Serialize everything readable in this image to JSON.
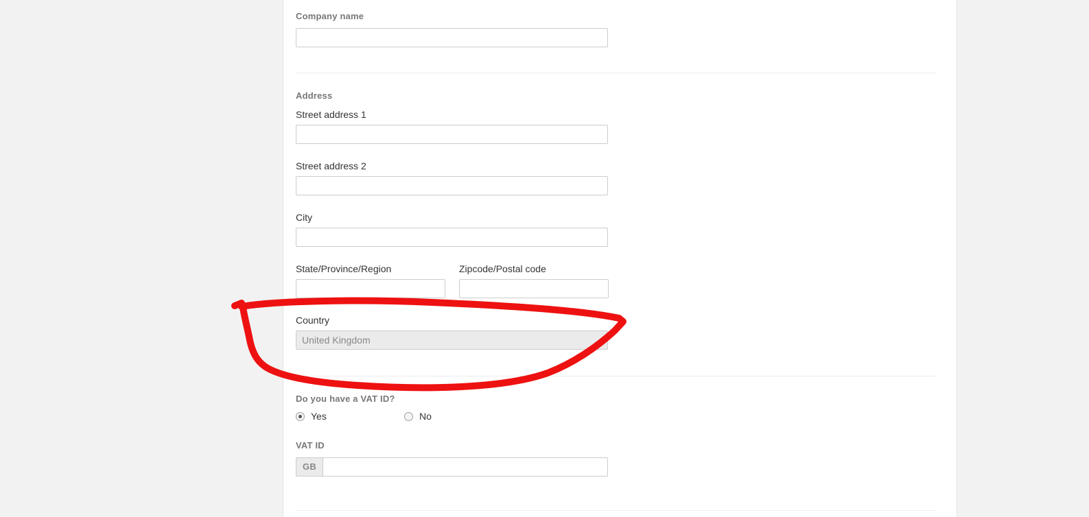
{
  "form": {
    "company": {
      "header": "Company name",
      "value": "",
      "placeholder": ""
    },
    "address": {
      "header": "Address",
      "street1": {
        "label": "Street address 1",
        "value": "",
        "placeholder": ""
      },
      "street2": {
        "label": "Street address 2",
        "value": "",
        "placeholder": ""
      },
      "city": {
        "label": "City",
        "value": "",
        "placeholder": ""
      },
      "state": {
        "label": "State/Province/Region",
        "value": "",
        "placeholder": ""
      },
      "zipcode": {
        "label": "Zipcode/Postal code",
        "value": "",
        "placeholder": ""
      },
      "country": {
        "label": "Country",
        "value": "United Kingdom",
        "disabled": true
      }
    },
    "vat": {
      "question": "Do you have a VAT ID?",
      "options": [
        {
          "label": "Yes",
          "selected": true
        },
        {
          "label": "No",
          "selected": false
        }
      ],
      "id_header": "VAT ID",
      "country_prefix": "GB",
      "id_value": "",
      "id_placeholder": ""
    }
  },
  "annotation": {
    "shape": "hand-drawn-ellipse",
    "target": "country-field",
    "color": "#ee1111"
  },
  "colors": {
    "page_background": "#f2f2f2",
    "panel_background": "#ffffff",
    "section_header_text": "#777777",
    "label_text": "#333333",
    "input_border": "#cccccc",
    "disabled_background": "#ebebeb",
    "disabled_text": "#888888",
    "divider": "#ededed",
    "annotation_red": "#ee1111"
  }
}
